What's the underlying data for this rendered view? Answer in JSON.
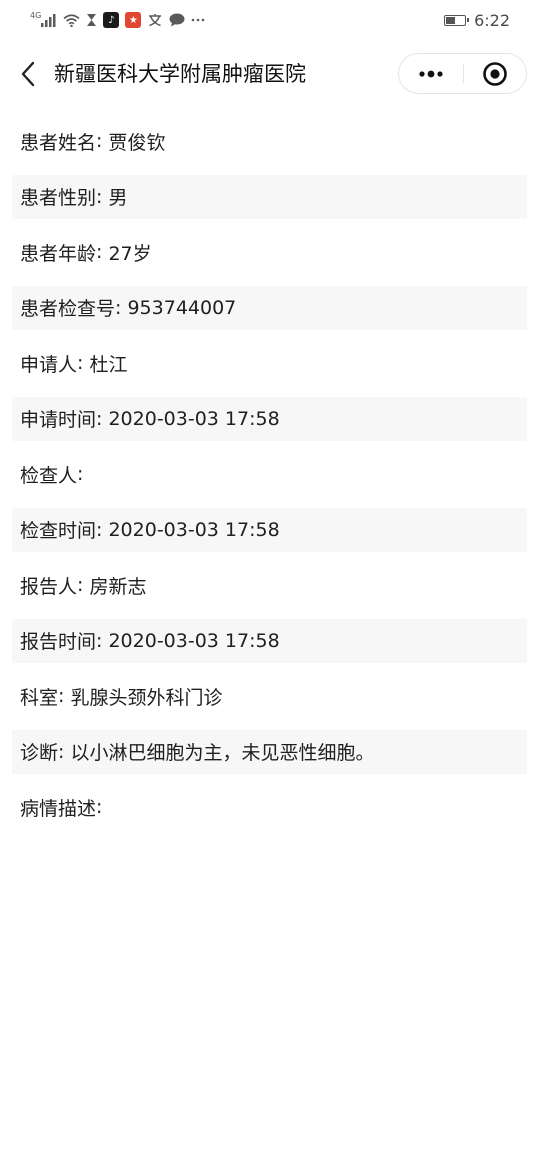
{
  "status_bar": {
    "network_label": "4G",
    "time": "6:22",
    "battery_level": 0.45,
    "notification_icons": [
      "signal-icon",
      "wifi-icon",
      "hourglass-icon",
      "tiktok-icon",
      "app-icon",
      "translate-icon",
      "chat-icon",
      "more-dots-icon"
    ]
  },
  "header": {
    "title": "新疆医科大学附属肿瘤医院"
  },
  "report": {
    "separator": ": ",
    "fields": [
      {
        "label": "患者姓名",
        "value": "贾俊钦"
      },
      {
        "label": "患者性别",
        "value": "男"
      },
      {
        "label": "患者年龄",
        "value": "27岁"
      },
      {
        "label": "患者检查号",
        "value": "953744007"
      },
      {
        "label": "申请人",
        "value": "杜江"
      },
      {
        "label": "申请时间",
        "value": "2020-03-03 17:58"
      },
      {
        "label": "检查人",
        "value": ""
      },
      {
        "label": "检查时间",
        "value": "2020-03-03 17:58"
      },
      {
        "label": "报告人",
        "value": "房新志"
      },
      {
        "label": "报告时间",
        "value": "2020-03-03 17:58"
      },
      {
        "label": "科室",
        "value": "乳腺头颈外科门诊"
      },
      {
        "label": "诊断",
        "value": "以小淋巴细胞为主，未见恶性细胞。"
      },
      {
        "label": "病情描述",
        "value": ""
      }
    ]
  },
  "colors": {
    "row_shade": "#f7f7f7",
    "text": "#1f1f1f"
  }
}
